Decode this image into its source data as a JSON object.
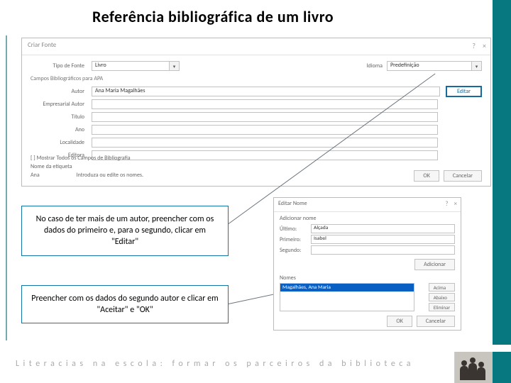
{
  "title": "Referência bibliográfica de um livro",
  "dlg1": {
    "windowTitle": "Criar Fonte",
    "helpIcon": "?",
    "closeIcon": "×",
    "tipoFonteLabel": "Tipo de Fonte",
    "tipoFonteValue": "Livro",
    "idiomaLabel": "Idioma",
    "idiomaValue": "Predefinição",
    "apaLine": "Campos Bibliográficos para APA",
    "autorLabel": "Autor",
    "autorValue": "Ana Maria Magalhães",
    "editarBtn": "Editar",
    "empresarialLabel": "Empresarial Autor",
    "tituloLabel": "Título",
    "anoLabel": "Ano",
    "localidadeLabel": "Localidade",
    "editoraLabel": "Editora",
    "mostrarTodos": "[ ] Mostrar Todos os Campos de Bibliografia",
    "nomeEtiquetaLabel": "Nome da etiqueta",
    "nomeEtiquetaHint": "Introduza ou edite os nomes.",
    "nomeEtiquetaValue": "Ana",
    "okBtn": "OK",
    "cancelBtn": "Cancelar"
  },
  "callout1": "No caso de ter mais de um autor, preencher com os dados do primeiro e, para o segundo, clicar em \"Editar\"",
  "callout2": "Preencher com os dados do segundo autor e clicar em \"Aceitar\" e \"OK\"",
  "dlg2": {
    "windowTitle": "Editar Nome",
    "helpIcon": "?",
    "closeIcon": "×",
    "adicionarNome": "Adicionar nome",
    "ultimoLabel": "Último:",
    "ultimoValue": "Alçada",
    "primeiroLabel": "Primeiro:",
    "primeiroValue": "Isabel",
    "segundoLabel": "Segundo:",
    "segundoValue": "",
    "adicionarBtn": "Adicionar",
    "nomesLabel": "Nomes",
    "listItem": "Magalhães, Ana Maria",
    "acimaBtn": "Acima",
    "abaixoBtn": "Abaixo",
    "eliminarBtn": "Eliminar",
    "okBtn": "OK",
    "cancelBtn": "Cancelar"
  },
  "footer": "Literacias na escola: formar os parceiros da biblioteca"
}
